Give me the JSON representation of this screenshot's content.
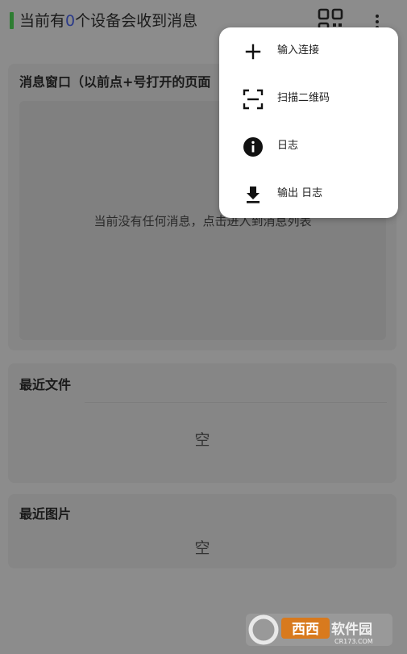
{
  "header": {
    "title_prefix": "当前有",
    "device_count": "0",
    "title_suffix": "个设备会收到消息",
    "icons": {
      "qr": "qr-code-icon",
      "more": "more-vertical-icon"
    },
    "accent_color": "#2e7d32"
  },
  "message_card": {
    "title": "消息窗口（以前点+号打开的页面",
    "empty_text": "当前没有任何消息，点击进入到消息列表"
  },
  "files_card": {
    "title": "最近文件",
    "empty_text": "空"
  },
  "pictures_card": {
    "title": "最近图片",
    "empty_text": "空"
  },
  "menu": {
    "items": [
      {
        "label": "输入连接",
        "icon": "plus-icon"
      },
      {
        "label": "扫描二维码",
        "icon": "scan-icon"
      },
      {
        "label": "日志",
        "icon": "info-icon"
      },
      {
        "label": "输出 日志",
        "icon": "download-icon"
      }
    ]
  },
  "watermark": {
    "text_main": "西西软件园",
    "text_sub": "CR173.COM"
  }
}
